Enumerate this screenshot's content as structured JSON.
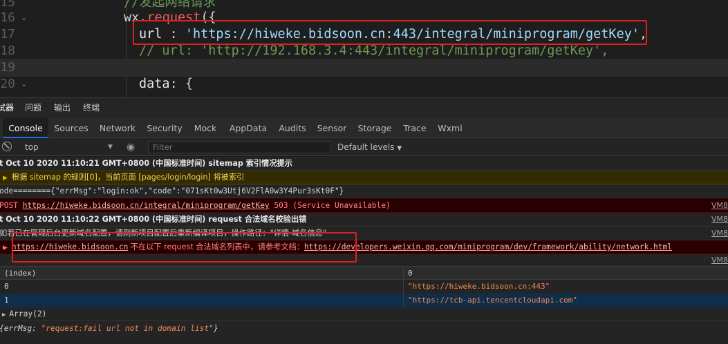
{
  "editor": {
    "lines": [
      {
        "num": "15",
        "comment": "//发起网络请求"
      },
      {
        "num": "16",
        "ident": "wx.",
        "func": "request",
        "open": "({"
      },
      {
        "num": "17",
        "key": "url",
        "sep": " : ",
        "value": "'https://hiweke.bidsoon.cn:443/integral/miniprogram/getKey'",
        "tail": ","
      },
      {
        "num": "18",
        "comment": "// url: 'http://192.168.3.4:443/integral/miniprogram/getKey',"
      },
      {
        "num": "19"
      },
      {
        "num": "20",
        "key": "data",
        "tail": ": {"
      }
    ]
  },
  "panel_tabs": [
    "试器",
    "问题",
    "输出",
    "终端"
  ],
  "devtools_tabs": [
    "Console",
    "Sources",
    "Network",
    "Security",
    "Mock",
    "AppData",
    "Audits",
    "Sensor",
    "Storage",
    "Trace",
    "Wxml"
  ],
  "toolbar": {
    "context": "top",
    "filter_placeholder": "Filter",
    "levels": "Default levels"
  },
  "console": {
    "r1": "t Oct 10 2020 11:10:21 GMT+0800 (中国标准时间) sitemap 索引情况提示",
    "r2": "根据 sitemap 的规则[0]，当前页面 [pages/login/login] 将被索引",
    "r3": "ode========{\"errMsg\":\"login:ok\",\"code\":\"071sKt0w3Utj6V2FlA0w3Y4Pur3sKt0F\"}",
    "r4_method": "POST ",
    "r4_url": "https://hiweke.bidsoon.cn/integral/miniprogram/getKey",
    "r4_status": " 503 (Service Unavailable)",
    "r4_src": "VM8",
    "r5": "t Oct 10 2020 11:10:22 GMT+0800 (中国标准时间) request 合法域名校验出错",
    "r5_src": "VM8",
    "r6": "如若已在管理后台更新域名配置，请刷新项目配置后重新编译项目，操作路径：\"详情-域名信息\"",
    "r6_src": "VM8",
    "r7_link": "https://hiweke.bidsoon.cn",
    "r7_msg": " 不在以下 request 合法域名列表中，请参考文档：",
    "r7_doc": "https://developers.weixin.qq.com/miniprogram/dev/framework/ability/network.html",
    "r8_src": "VM8",
    "table_head": [
      "(index)",
      "0"
    ],
    "table_rows": [
      [
        "0",
        "\"https://hiweke.bidsoon.cn:443\""
      ],
      [
        "1",
        "\"https://tcb-api.tencentcloudapi.com\""
      ]
    ],
    "array_label": "Array(2)",
    "errmsg_key": "{errMsg: ",
    "errmsg_val": "\"request:fail url not in domain list\"",
    "errmsg_close": "}"
  },
  "colors": {
    "accent": "#1a73e8",
    "highlight_box": "#e02020",
    "error_bg": "#290000",
    "warn_bg": "#332b00"
  }
}
